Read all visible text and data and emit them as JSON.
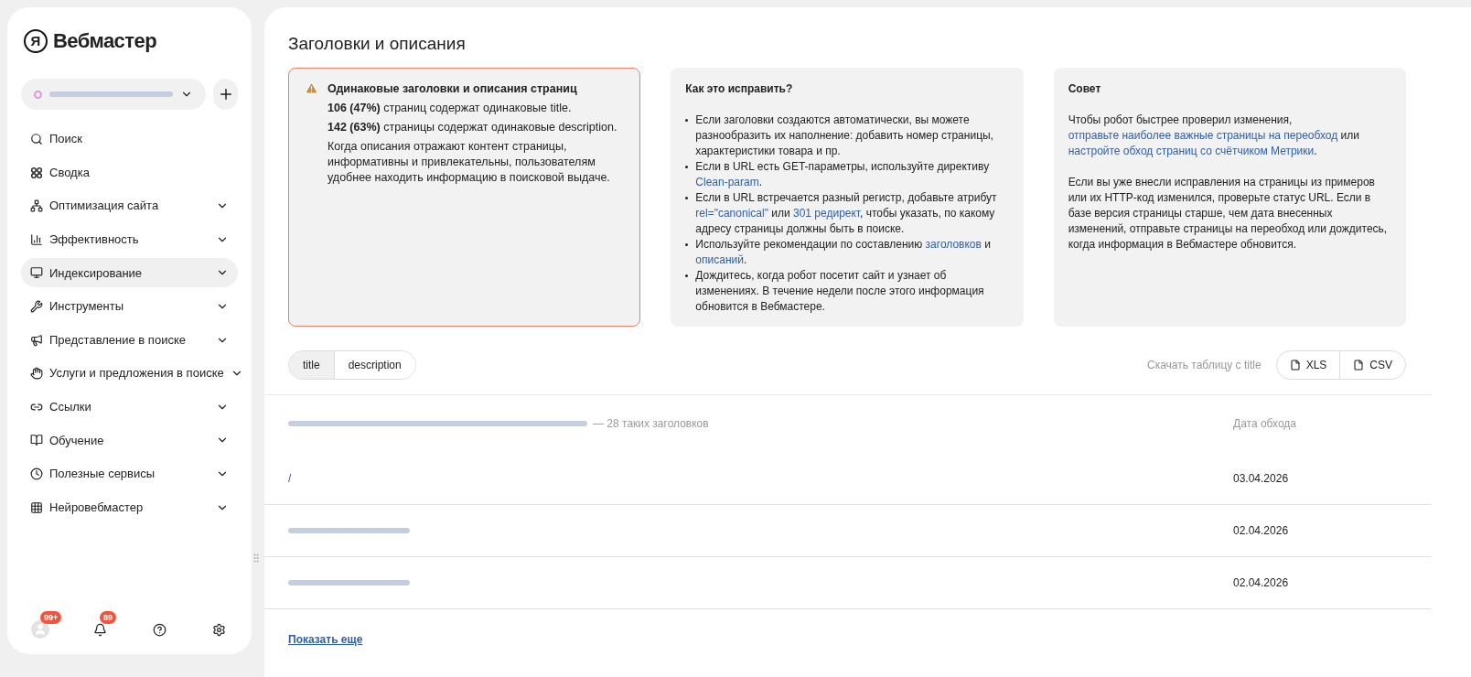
{
  "sidebar": {
    "logo": {
      "mark": "Я",
      "text": "Вебмастер"
    },
    "nav": [
      {
        "label": "Поиск",
        "kind": "link",
        "selected": false
      },
      {
        "label": "Сводка",
        "kind": "link",
        "selected": false
      },
      {
        "label": "Оптимизация сайта",
        "kind": "group",
        "selected": false
      },
      {
        "label": "Эффективность",
        "kind": "group",
        "selected": false
      },
      {
        "label": "Индексирование",
        "kind": "group",
        "selected": true
      },
      {
        "label": "Инструменты",
        "kind": "group",
        "selected": false
      },
      {
        "label": "Представление в поиске",
        "kind": "group",
        "selected": false
      },
      {
        "label": "Услуги и предложения в поиске",
        "kind": "group",
        "selected": false
      },
      {
        "label": "Ссылки",
        "kind": "group",
        "selected": false
      },
      {
        "label": "Обучение",
        "kind": "group",
        "selected": false
      },
      {
        "label": "Полезные сервисы",
        "kind": "group",
        "selected": false
      },
      {
        "label": "Нейровебмастер",
        "kind": "group",
        "selected": false
      }
    ],
    "footer": [
      {
        "kind": "avatar",
        "badge": "99+"
      },
      {
        "kind": "bell",
        "badge": "89"
      },
      {
        "kind": "help"
      },
      {
        "kind": "settings"
      }
    ]
  },
  "page": {
    "title": "Заголовки и описания",
    "alert": {
      "title": "Одинаковые заголовки и описания страниц",
      "lines": [
        "**106 (47%)** страниц содержат одинаковые title.",
        "**142 (63%)** страницы содержат одинаковые description.",
        "Когда описания отражают контент страницы, информативны и привлекательны, пользователям удобнее находить информацию в поисковой выдаче."
      ]
    },
    "fix": {
      "title": "Как это исправить?",
      "items": [
        [
          {
            "text": "Если заголовки создаются автоматически, вы можете разнообразить их наполнение: добавить номер страницы, характеристики товара и пр."
          }
        ],
        [
          {
            "text": "Если в URL есть GET-параметры, используйте директиву "
          },
          {
            "text": "Clean-param",
            "link": true
          },
          {
            "text": "."
          }
        ],
        [
          {
            "text": "Если в URL встречается разный регистр, добавьте атрибут "
          },
          {
            "text": "rel=\"canonical\"",
            "link": true
          },
          {
            "text": " или "
          },
          {
            "text": "301 редирект",
            "link": true
          },
          {
            "text": ", чтобы указать, по какому адресу страницы должны быть в поиске."
          }
        ],
        [
          {
            "text": "Используйте рекомендации по составлению "
          },
          {
            "text": "заголовков",
            "link": true
          },
          {
            "text": " и "
          },
          {
            "text": "описаний",
            "link": true
          },
          {
            "text": "."
          }
        ],
        [
          {
            "text": "Дождитесь, когда робот посетит сайт и узнает об изменениях. В течение недели после этого информация обновится в Вебмастере."
          }
        ]
      ]
    },
    "tip": {
      "title": "Совет",
      "paragraphs": [
        [
          {
            "text": "Чтобы робот быстрее проверил изменения, "
          },
          {
            "text": "отправьте наиболее важные страницы на переобход",
            "link": true
          },
          {
            "text": " или "
          },
          {
            "text": "настройте обход страниц со счётчиком Метрики",
            "link": true
          },
          {
            "text": "."
          }
        ],
        [
          {
            "text": "Если вы уже внесли исправления на страницы из примеров или их HTTP-код изменился, проверьте статус URL. Если в базе версия страницы старше, чем дата внесенных изменений, отправьте страницы на переобход или дождитесь, когда информация в Вебмастере обновится."
          }
        ]
      ]
    },
    "tabs": [
      {
        "label": "title",
        "selected": true
      },
      {
        "label": "description",
        "selected": false
      }
    ],
    "download": {
      "label": "Скачать таблицу с title",
      "buttons": [
        "XLS",
        "CSV"
      ]
    },
    "table": {
      "group_count": "— 28 таких заголовков",
      "date_header": "Дата обхода",
      "rows": [
        {
          "kind": "link",
          "url": "/",
          "date": "03.04.2026"
        },
        {
          "kind": "hidden",
          "date": "02.04.2026"
        },
        {
          "kind": "hidden",
          "date": "02.04.2026"
        }
      ]
    },
    "show_more": "Показать еще"
  }
}
